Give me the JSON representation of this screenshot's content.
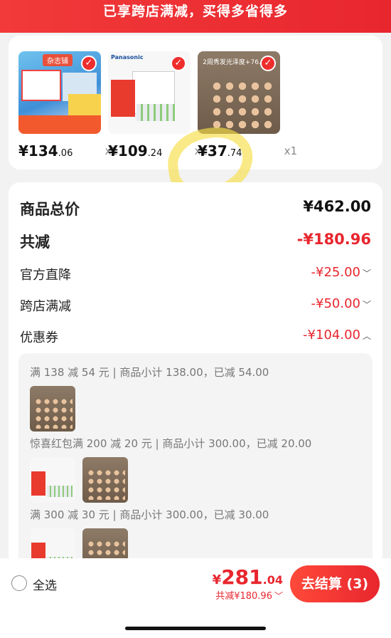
{
  "banner": {
    "text": "已享跨店满减，买得多省得多"
  },
  "products": [
    {
      "price_main": "¥134",
      "price_cents": ".06",
      "qty": "x1",
      "thumb_tag": "杂志铺",
      "name": "magazine-bundle"
    },
    {
      "price_main": "¥109",
      "price_cents": ".24",
      "qty": "x1",
      "thumb_brand": "Panasonic",
      "name": "panasonic-charger"
    },
    {
      "price_main": "¥37",
      "price_cents": ".74",
      "qty": "x1",
      "thumb_band": "2周秀发光泽度+76.28%",
      "name": "hair-care-pack"
    }
  ],
  "summary": {
    "goods_total_label": "商品总价",
    "goods_total_value": "¥462.00",
    "total_discount_label": "共减",
    "total_discount_value": "-¥180.96",
    "official_label": "官方直降",
    "official_value": "-¥25.00",
    "cross_store_label": "跨店满减",
    "cross_store_value": "-¥50.00",
    "coupon_label": "优惠券",
    "coupon_value": "-¥104.00"
  },
  "coupons": [
    {
      "text": "满 138 减 54 元 | 商品小计 138.00，已减 54.00"
    },
    {
      "text": "惊喜红包满 200 减 20 元 | 商品小计 300.00，已减 20.00"
    },
    {
      "text": "满 300 减 30 元 | 商品小计 300.00，已减 30.00"
    }
  ],
  "bottom": {
    "select_all": "全选",
    "total_currency": "¥",
    "total_main": "281",
    "total_cents": ".04",
    "discount_text": "共减¥180.96",
    "checkout": "去结算 (3)"
  },
  "colors": {
    "accent": "#e8262e",
    "highlight": "#f6de46"
  }
}
